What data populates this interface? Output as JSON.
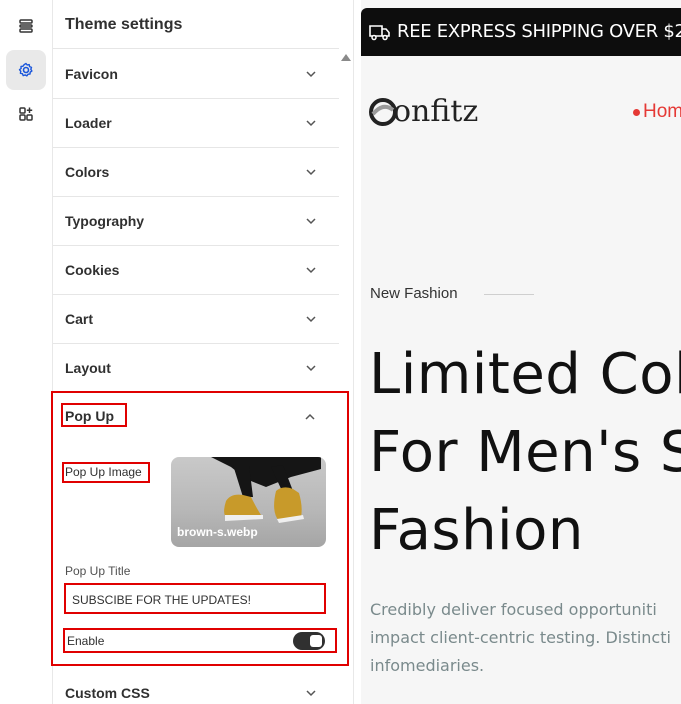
{
  "panel": {
    "title": "Theme settings",
    "sections": [
      {
        "label": "Favicon"
      },
      {
        "label": "Loader"
      },
      {
        "label": "Colors"
      },
      {
        "label": "Typography"
      },
      {
        "label": "Cookies"
      },
      {
        "label": "Cart"
      },
      {
        "label": "Layout"
      }
    ],
    "popup": {
      "label": "Pop Up",
      "image_label": "Pop Up Image",
      "image_filename": "brown-s.webp",
      "title_label": "Pop Up Title",
      "title_value": "SUBSCIBE FOR THE UPDATES!",
      "enable_label": "Enable",
      "enabled": true
    },
    "custom_css_label": "Custom CSS"
  },
  "rail": {
    "icons": [
      "sections-icon",
      "gear-icon",
      "apps-add-icon"
    ],
    "active": "gear-icon"
  },
  "preview": {
    "announcement": "REE EXPRESS SHIPPING OVER $2",
    "logo": "onfitz",
    "nav_home": "Hom",
    "kicker": "New Fashion",
    "headline": [
      "Limited Col",
      "For Men's S",
      "Fashion"
    ],
    "paragraph": [
      "Credibly deliver focused opportuniti",
      "impact client-centric testing. Distincti",
      "infomediaries."
    ]
  },
  "colors": {
    "highlight": "#e00000",
    "nav_accent": "#e53935",
    "toggle_on": "#303030"
  }
}
